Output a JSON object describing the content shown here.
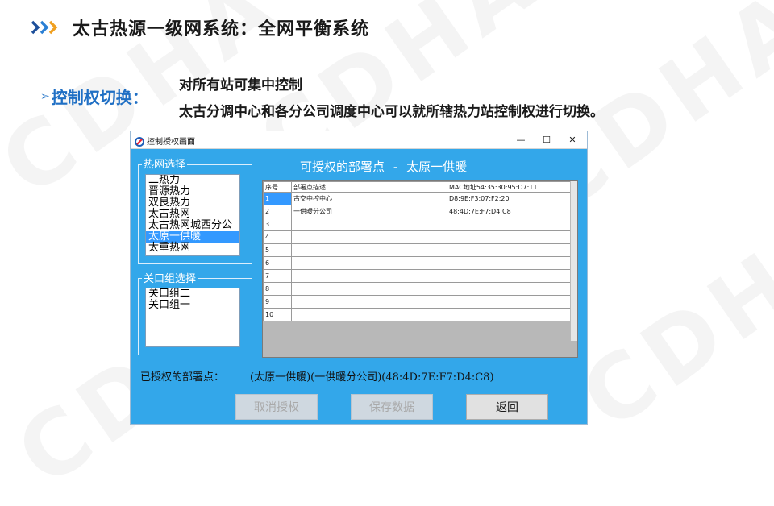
{
  "slide": {
    "title": "太古热源一级网系统：全网平衡系统",
    "sub_label": "控制权切换：",
    "desc1": "对所有站可集中控制",
    "desc2": "太古分调中心和各分公司调度中心可以就所辖热力站控制权进行切换。",
    "watermark": "CDHA"
  },
  "window": {
    "title": "控制授权画面",
    "minimize": "—",
    "maximize": "☐",
    "close": "✕"
  },
  "heat_net_group": {
    "label": "热网选择",
    "items": [
      "二热力",
      "晋源热力",
      "双良热力",
      "太古热网",
      "太古热网城西分公",
      "太原一供暖",
      "太重热网"
    ],
    "selected_index": 5
  },
  "gate_group": {
    "label": "关口组选择",
    "items": [
      "关口组二",
      "关口组一"
    ]
  },
  "main_title": "可授权的部署点 - 太原一供暖",
  "table": {
    "headers": [
      "序号",
      "部署点描述",
      "MAC地址54:35:30:95:D7:11"
    ],
    "rows": [
      [
        "1",
        "古交中控中心",
        "D8:9E:F3:07:F2:20"
      ],
      [
        "2",
        "一供暖分公司",
        "48:4D:7E:F7:D4:C8"
      ],
      [
        "3",
        "",
        ""
      ],
      [
        "4",
        "",
        ""
      ],
      [
        "5",
        "",
        ""
      ],
      [
        "6",
        "",
        ""
      ],
      [
        "7",
        "",
        ""
      ],
      [
        "8",
        "",
        ""
      ],
      [
        "9",
        "",
        ""
      ],
      [
        "10",
        "",
        ""
      ]
    ]
  },
  "authorized": {
    "label": "已授权的部署点：",
    "value": "(太原一供暖)(一供暖分公司)(48:4D:7E:F7:D4:C8)"
  },
  "buttons": {
    "cancel": "取消授权",
    "save": "保存数据",
    "back": "返回"
  }
}
